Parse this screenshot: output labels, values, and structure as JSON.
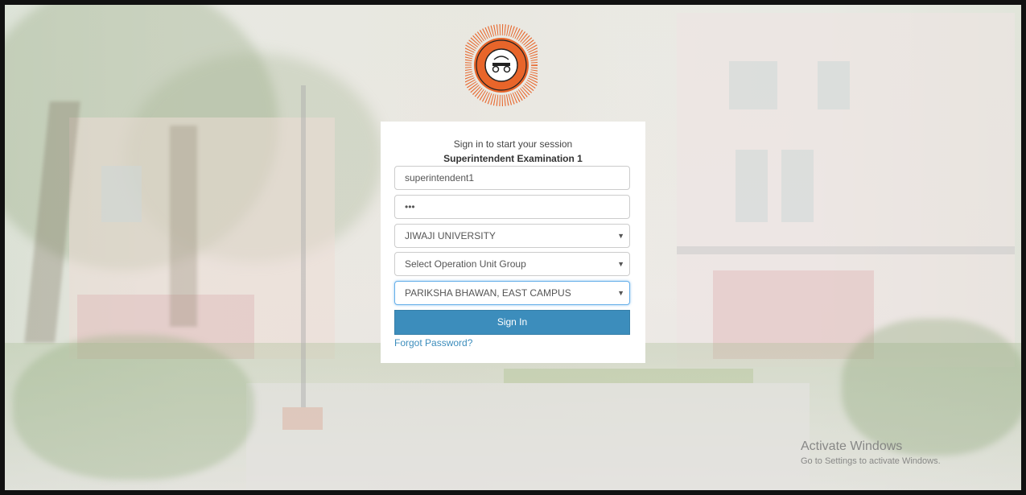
{
  "login": {
    "subtitle": "Sign in to start your session",
    "heading": "Superintendent Examination 1",
    "username_value": "superintendent1",
    "password_masked": "•••",
    "university_select": "JIWAJI UNIVERSITY",
    "unit_group_select": "Select Operation Unit Group",
    "center_select": "PARIKSHA BHAWAN, EAST CAMPUS",
    "sign_in_label": "Sign In",
    "forgot_label": "Forgot Password?"
  },
  "watermark": {
    "title": "Activate Windows",
    "subtitle": "Go to Settings to activate Windows."
  },
  "colors": {
    "primary": "#3c8dbc",
    "logo_orange": "#e8652a"
  },
  "icons": {
    "caret": "caret-down-icon",
    "logo": "university-logo"
  }
}
